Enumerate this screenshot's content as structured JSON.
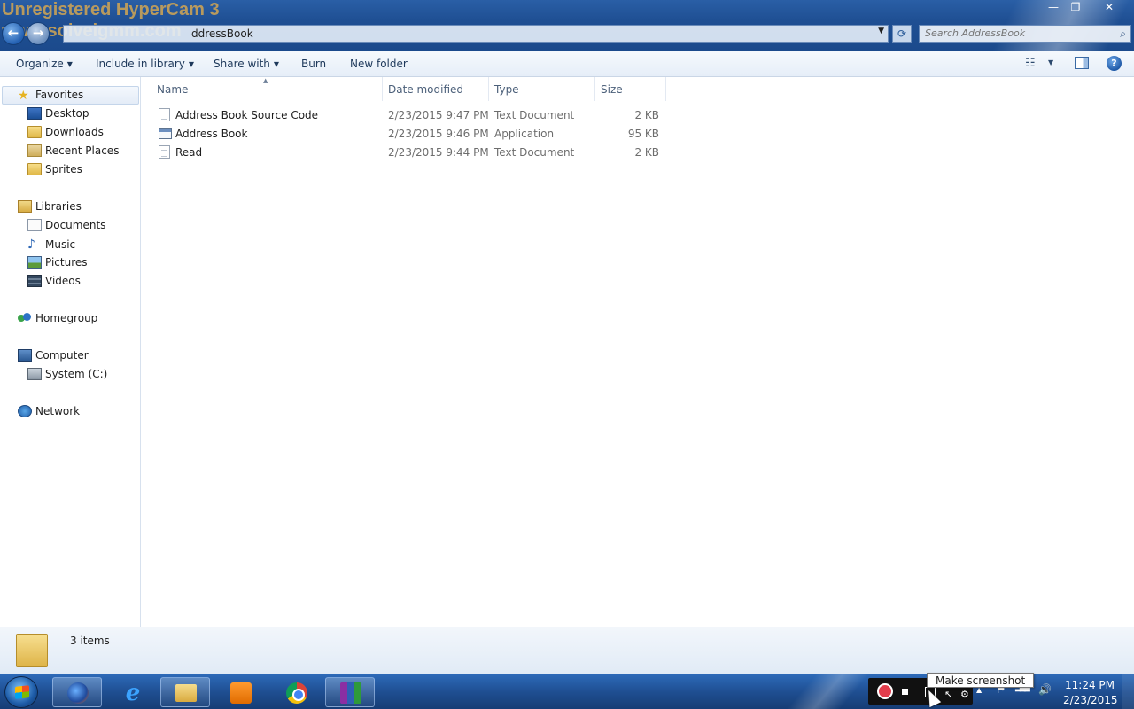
{
  "watermark": {
    "line1": "Unregistered HyperCam 3",
    "line2": "www.solveigmm.com"
  },
  "window_controls": {
    "minimize": "—",
    "maximize": "❐",
    "close": "✕"
  },
  "address_bar": {
    "crumbs": [
      "ddressBook"
    ],
    "dropdown": "▼",
    "refresh": "⟳"
  },
  "search": {
    "placeholder": "Search AddressBook",
    "icon": "⌕"
  },
  "command_bar": {
    "organize": "Organize",
    "include_in_library": "Include in library",
    "share_with": "Share with",
    "burn": "Burn",
    "new_folder": "New folder",
    "help": "?"
  },
  "nav_pane": {
    "favorites": {
      "label": "Favorites",
      "items": [
        {
          "label": "Desktop",
          "icon": "desktop-icon"
        },
        {
          "label": "Downloads",
          "icon": "folder-icon"
        },
        {
          "label": "Recent Places",
          "icon": "recent-places-icon"
        },
        {
          "label": "Sprites",
          "icon": "folder-icon"
        }
      ]
    },
    "libraries": {
      "label": "Libraries",
      "items": [
        {
          "label": "Documents",
          "icon": "documents-icon"
        },
        {
          "label": "Music",
          "icon": "music-icon"
        },
        {
          "label": "Pictures",
          "icon": "pictures-icon"
        },
        {
          "label": "Videos",
          "icon": "videos-icon"
        }
      ]
    },
    "homegroup": {
      "label": "Homegroup"
    },
    "computer": {
      "label": "Computer",
      "items": [
        {
          "label": "System (C:)",
          "icon": "drive-icon"
        }
      ]
    },
    "network": {
      "label": "Network"
    }
  },
  "file_list": {
    "columns": [
      "Name",
      "Date modified",
      "Type",
      "Size"
    ],
    "sort_indicator": "▲",
    "rows": [
      {
        "name": "Address Book Source Code",
        "date": "2/23/2015 9:47 PM",
        "type": "Text Document",
        "size": "2 KB",
        "icon": "text-file-icon"
      },
      {
        "name": "Address Book",
        "date": "2/23/2015 9:46 PM",
        "type": "Application",
        "size": "95 KB",
        "icon": "application-icon"
      },
      {
        "name": "Read",
        "date": "2/23/2015 9:44 PM",
        "type": "Text Document",
        "size": "2 KB",
        "icon": "text-file-icon"
      }
    ]
  },
  "details_pane": {
    "item_count": "3 items"
  },
  "taskbar": {
    "apps": [
      "firefox-icon",
      "internet-explorer-icon",
      "windows-explorer-icon",
      "media-player-icon",
      "chrome-icon",
      "winrar-icon"
    ],
    "ie_glyph": "e",
    "tooltip": "Make screenshot",
    "tray_glyphs": {
      "up": "▲",
      "flag": "⚑",
      "signal": "▂▄▆",
      "volume": "🔊"
    },
    "clock_time": "11:24 PM",
    "clock_date": "2/23/2015"
  },
  "colors": {
    "titlebar": "#1f4f93",
    "taskbar": "#1f4f92",
    "command_bar": "#e6eef8",
    "link_text": "#1e395b"
  }
}
